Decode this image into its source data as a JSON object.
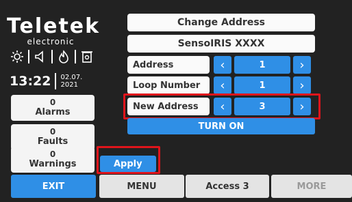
{
  "brand": {
    "name": "Teletek",
    "subtitle": "electronic"
  },
  "clock": {
    "time": "13:22",
    "date_line1": "02.07.",
    "date_line2": "2021"
  },
  "status": {
    "alarms": {
      "count": "0",
      "label": "Alarms"
    },
    "faults": {
      "count": "0",
      "label": "Faults"
    },
    "warnings": {
      "count": "0",
      "label": "Warnings"
    }
  },
  "main": {
    "title": "Change Address",
    "device": "SensoIRIS XXXX",
    "rows": [
      {
        "label": "Address",
        "value": "1"
      },
      {
        "label": "Loop Number",
        "value": "1"
      },
      {
        "label": "New Address",
        "value": "3"
      }
    ],
    "turn_on_label": "TURN ON",
    "apply_label": "Apply"
  },
  "bottom": {
    "exit": "EXIT",
    "menu": "MENU",
    "access": "Access 3",
    "more": "MORE"
  },
  "colors": {
    "accent": "#2f8fe6",
    "highlight": "#e0141b",
    "background": "#222222"
  },
  "icons": [
    "sun-icon",
    "speaker-icon",
    "fire-icon",
    "door-icon",
    "chevron-left-icon",
    "chevron-right-icon"
  ]
}
